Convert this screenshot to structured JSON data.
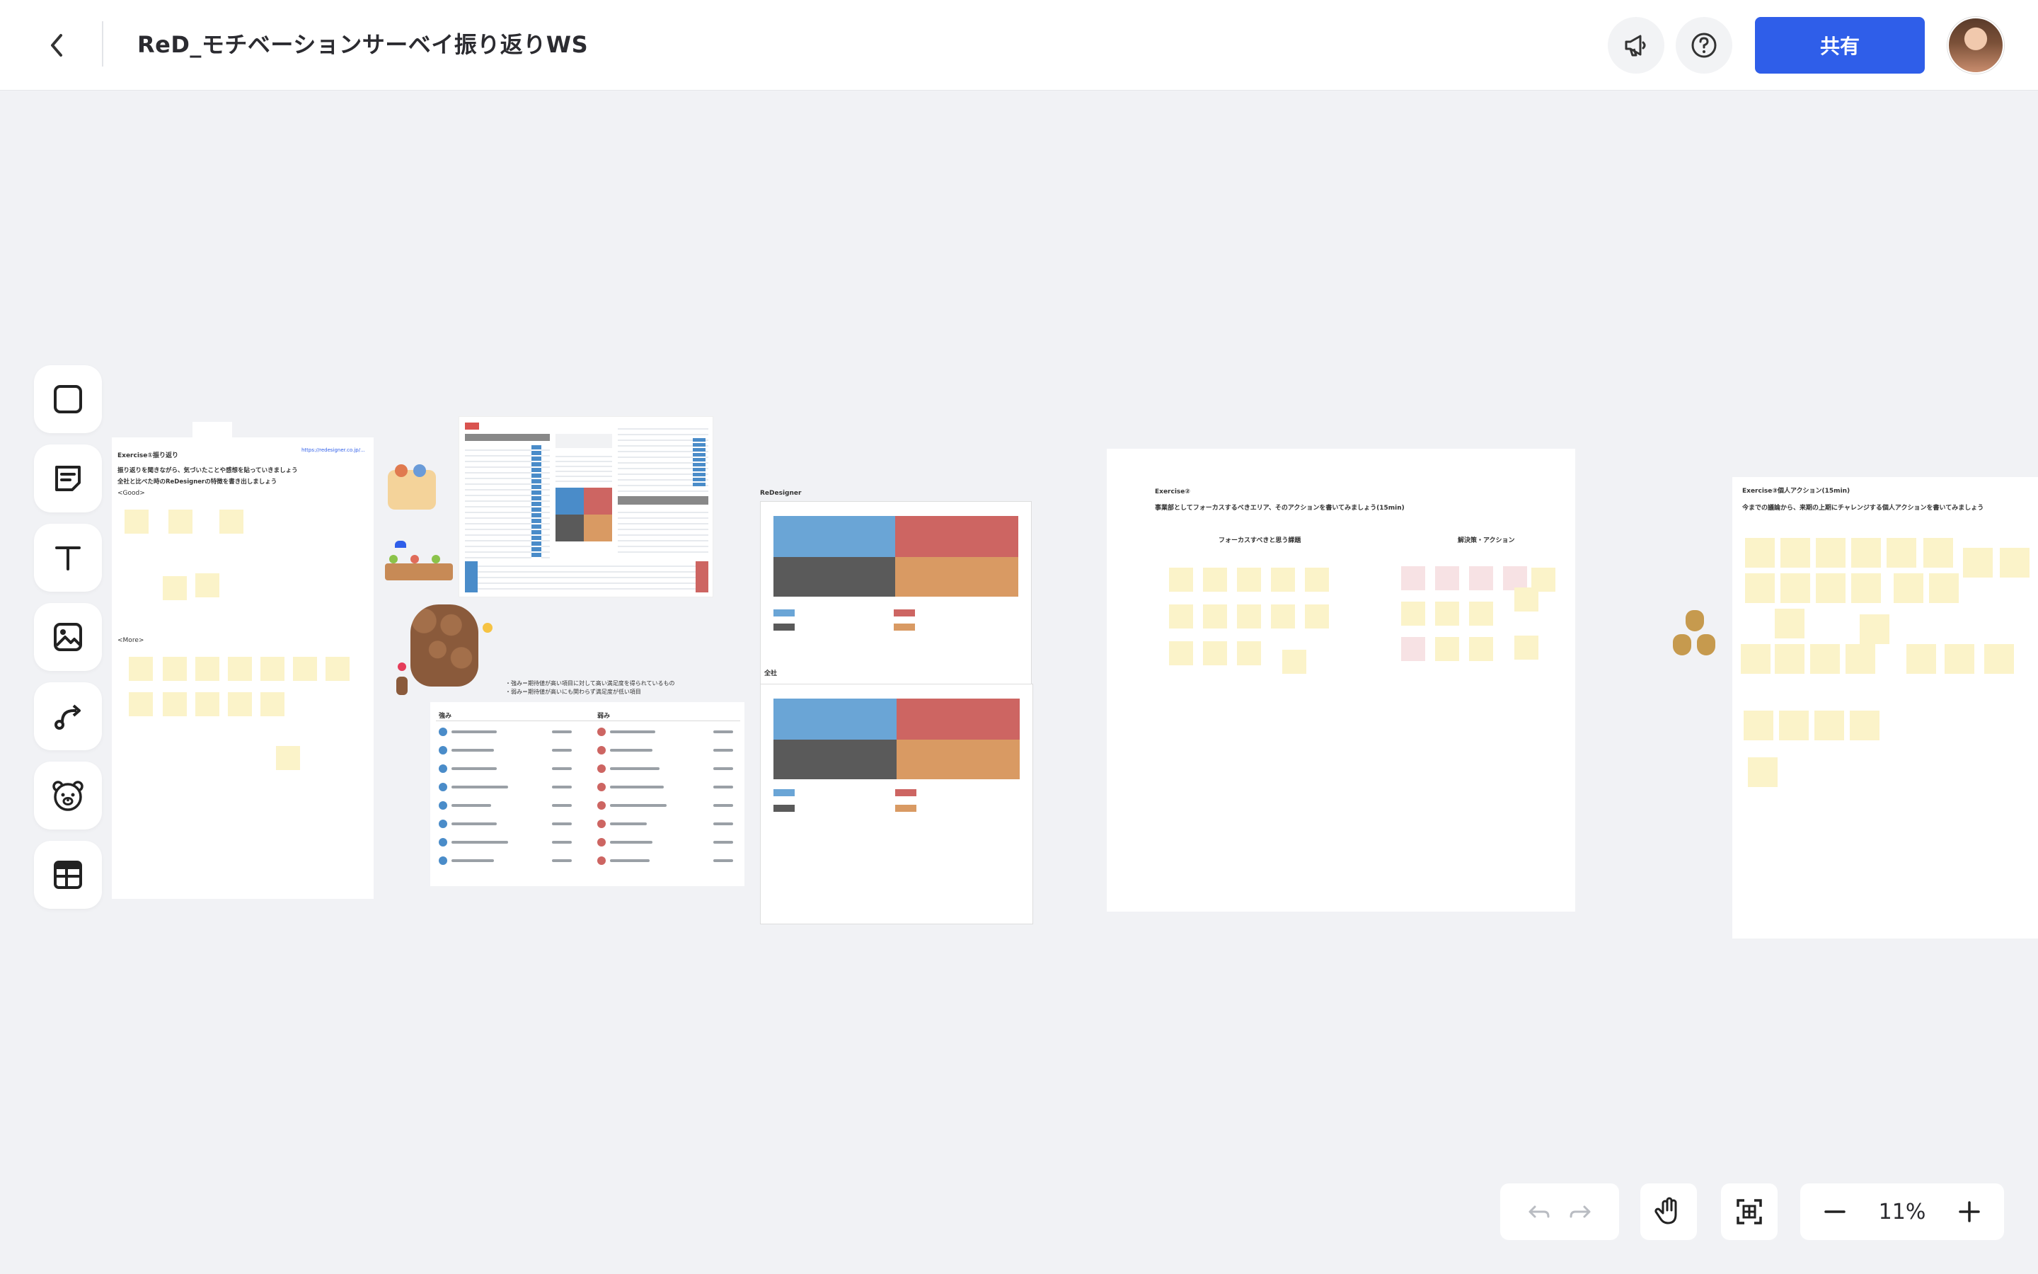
{
  "header": {
    "board_title": "ReD_モチベーションサーベイ振り返りWS",
    "share_label": "共有"
  },
  "zoom": {
    "level": "11%"
  },
  "canvas": {
    "frame1": {
      "title": "Exercise①振り返り",
      "line1": "振り返りを聞きながら、気づいたことや感想を貼っていきましょう",
      "line2": "全社と比べた時のReDesignerの特徴を書き出しましょう",
      "good": "<Good>",
      "more": "<More>",
      "link": "https://redesigner.co.jp/..."
    },
    "matrix1": {
      "title": "ReDesigner"
    },
    "matrix2": {
      "title": "全社"
    },
    "list_frame": {
      "note1": "・強み＝期待値が高い項目に対して高い満足度を得られているもの",
      "note2": "・弱み＝期待値が高いにも関わらず満足度が低い項目",
      "col_strength": "強み",
      "col_weakness": "弱み"
    },
    "frame3": {
      "title": "Exercise②",
      "subtitle": "事業部としてフォーカスするべきエリア、そのアクションを書いてみましょう(15min)",
      "col1": "フォーカスすべきと思う課題",
      "col2": "解決策・アクション"
    },
    "frame4": {
      "title": "Exercise③個人アクション(15min)",
      "subtitle": "今までの議論から、来期の上期にチャレンジする個人アクションを書いてみましょう"
    }
  },
  "colors": {
    "accent": "#2f5ee9",
    "matrix_blue": "#6aa5d6",
    "matrix_red": "#cd6562",
    "matrix_gray": "#5a5a5a",
    "matrix_orange": "#d99a63",
    "sticky": "#fbf3c9"
  },
  "icons": {
    "back": "chevron-left-icon",
    "announce": "megaphone-icon",
    "help": "question-circle-icon"
  }
}
